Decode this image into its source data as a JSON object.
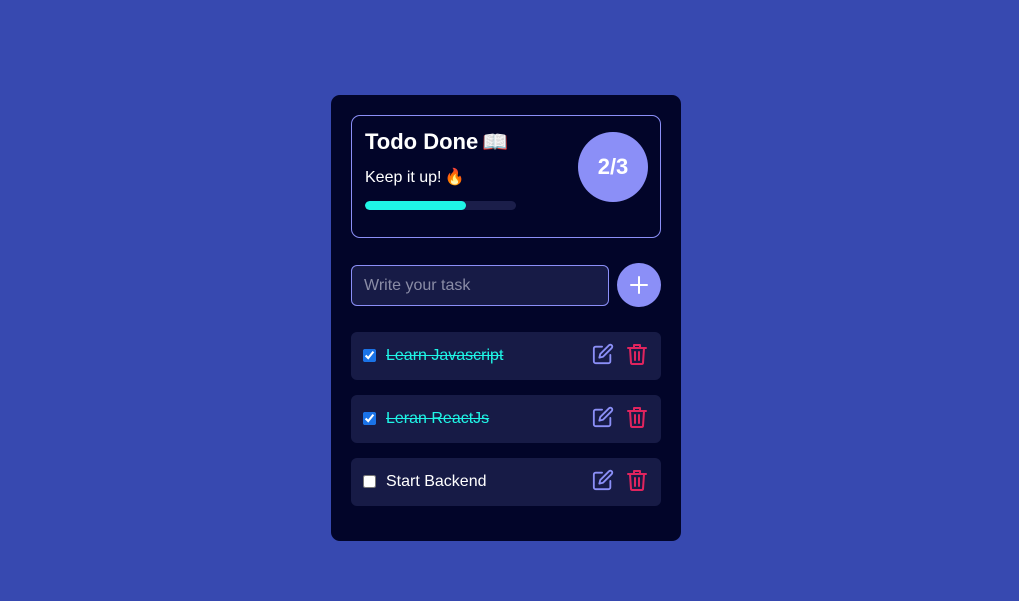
{
  "stats": {
    "title": "Todo Done",
    "title_emoji": "📖",
    "subtitle": "Keep it up!",
    "subtitle_emoji": "🔥",
    "count": "2/3",
    "progress_fraction": 0.667
  },
  "input": {
    "placeholder": "Write your task",
    "value": ""
  },
  "add_button": {
    "icon": "plus-icon"
  },
  "todos": [
    {
      "label": "Learn Javascript",
      "done": true
    },
    {
      "label": "Leran ReactJs",
      "done": true
    },
    {
      "label": "Start Backend",
      "done": false
    }
  ],
  "colors": {
    "background": "#3749b0",
    "card": "#020529",
    "accent": "#8b8ff7",
    "done_text": "#1ff5e6",
    "delete": "#e0245e"
  }
}
